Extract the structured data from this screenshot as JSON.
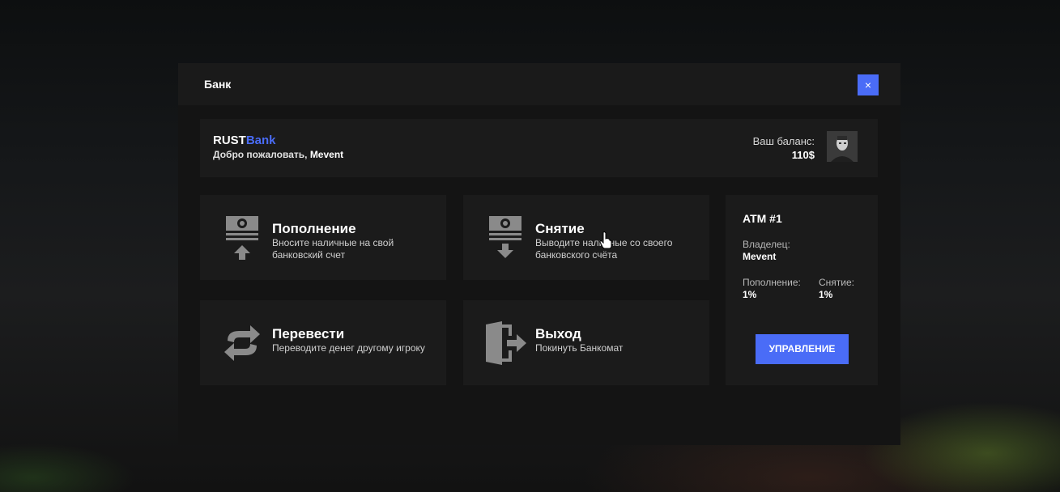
{
  "window": {
    "title": "Банк",
    "close_label": "×"
  },
  "header_bar": {
    "brand_main": "RUST",
    "brand_accent": "Bank",
    "welcome_prefix": "Добро пожаловать,",
    "username": "Mevent",
    "balance_label": "Ваш баланс:",
    "balance_value": "110$"
  },
  "actions": [
    {
      "title": "Пополнение",
      "description": "Вносите наличные на свой банковский счет",
      "icon": "deposit-icon"
    },
    {
      "title": "Снятие",
      "description": "Выводите наличные со своего банковского счёта",
      "icon": "withdraw-icon"
    },
    {
      "title": "Перевести",
      "description": "Переводите денег другому игроку",
      "icon": "transfer-icon"
    },
    {
      "title": "Выход",
      "description": "Покинуть Банкомат",
      "icon": "exit-icon"
    }
  ],
  "atm": {
    "title": "ATM #1",
    "owner_label": "Владелец:",
    "owner_value": "Mevent",
    "deposit_fee_label": "Пополнение:",
    "deposit_fee_value": "1%",
    "withdraw_fee_label": "Снятие:",
    "withdraw_fee_value": "1%",
    "manage_label": "УПРАВЛЕНИЕ"
  },
  "colors": {
    "accent": "#4a6cf7",
    "panel": "#1b1b1b",
    "window": "#141414",
    "icon": "#8a8a8a"
  }
}
